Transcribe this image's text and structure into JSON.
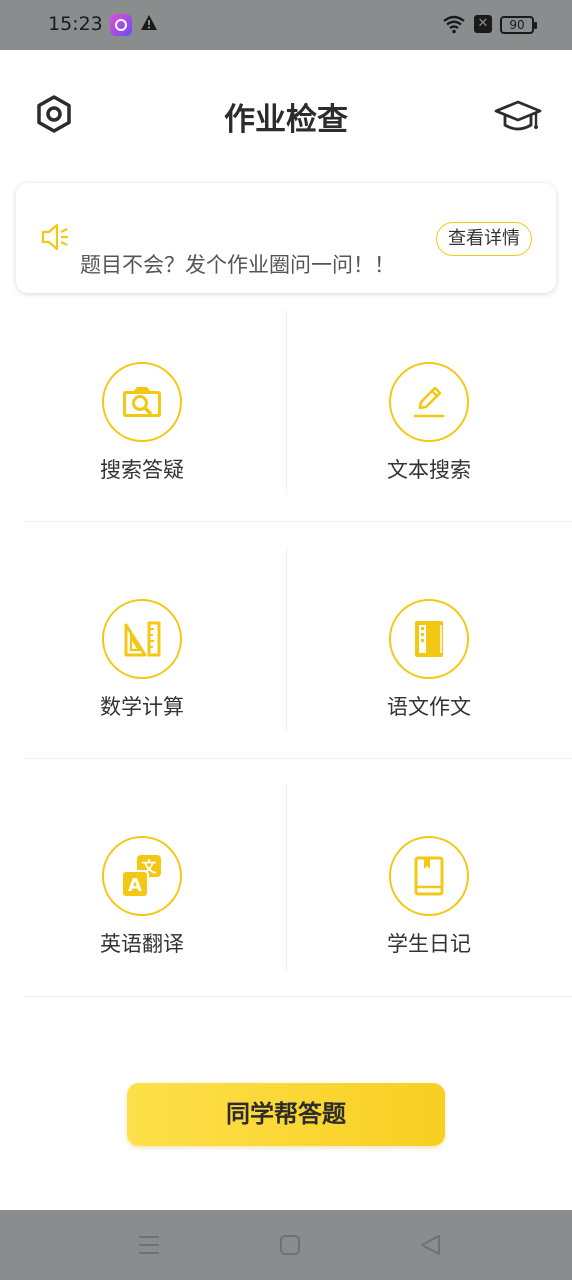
{
  "status_bar": {
    "time": "15:23",
    "battery": "90",
    "icons": [
      "app-icon",
      "warning-icon",
      "wifi-icon",
      "x-icon",
      "battery-icon"
    ]
  },
  "header": {
    "title": "作业检查",
    "left_icon": "settings-icon",
    "right_icon": "graduation-cap-icon"
  },
  "notice": {
    "icon": "speaker-icon",
    "text": "题目不会？发个作业圈问一问！！",
    "detail_label": "查看详情"
  },
  "features": [
    {
      "label": "搜索答疑",
      "icon": "camera-search-icon"
    },
    {
      "label": "文本搜索",
      "icon": "pen-icon"
    },
    {
      "label": "数学计算",
      "icon": "ruler-triangle-icon"
    },
    {
      "label": "语文作文",
      "icon": "notebook-icon"
    },
    {
      "label": "英语翻译",
      "icon": "translate-icon"
    },
    {
      "label": "学生日记",
      "icon": "diary-icon"
    }
  ],
  "helper_button": {
    "label": "同学帮答题"
  },
  "nav_bar": {
    "icons": [
      "menu-icon",
      "home-square-icon",
      "back-triangle-icon"
    ]
  },
  "colors": {
    "accent": "#F3C814",
    "button_start": "#FDE04A",
    "button_end": "#F8CF22",
    "system_bar": "#8A8D8E"
  }
}
